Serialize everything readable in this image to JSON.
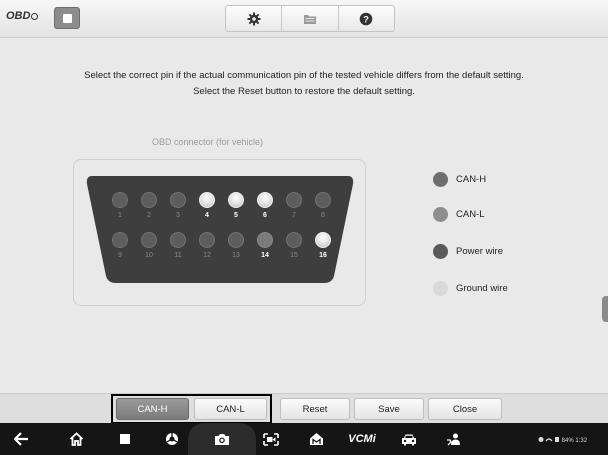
{
  "topbar": {
    "logo_text": "OBD",
    "stop_icon": "stop-square-icon",
    "buttons": [
      {
        "name": "settings",
        "icon": "gear-icon"
      },
      {
        "name": "files",
        "icon": "folder-icon"
      },
      {
        "name": "help",
        "icon": "help-icon"
      }
    ]
  },
  "instruction": {
    "line1": "Select the correct pin if the actual communication pin of the tested vehicle differs from the default setting.",
    "line2": "Select the Reset button to restore the default setting."
  },
  "connector": {
    "label": "OBD connector (for vehicle)",
    "top_row": [
      {
        "num": "1",
        "state": "off"
      },
      {
        "num": "2",
        "state": "off"
      },
      {
        "num": "3",
        "state": "off"
      },
      {
        "num": "4",
        "state": "ground"
      },
      {
        "num": "5",
        "state": "ground"
      },
      {
        "num": "6",
        "state": "ground"
      },
      {
        "num": "7",
        "state": "off"
      },
      {
        "num": "8",
        "state": "off"
      }
    ],
    "bottom_row": [
      {
        "num": "9",
        "state": "off"
      },
      {
        "num": "10",
        "state": "off"
      },
      {
        "num": "11",
        "state": "off"
      },
      {
        "num": "12",
        "state": "off"
      },
      {
        "num": "13",
        "state": "off"
      },
      {
        "num": "14",
        "state": "power"
      },
      {
        "num": "15",
        "state": "off"
      },
      {
        "num": "16",
        "state": "ground"
      }
    ]
  },
  "legend": {
    "items": [
      {
        "label": "CAN-H",
        "color": "#6f6f6f"
      },
      {
        "label": "CAN-L",
        "color": "#8e8e8e"
      },
      {
        "label": "Power wire",
        "color": "#5a5a5a"
      },
      {
        "label": "Ground wire",
        "color": "#d9d9d9"
      }
    ]
  },
  "bottom_toolbar": {
    "can_h": "CAN-H",
    "can_l": "CAN-L",
    "reset": "Reset",
    "save": "Save",
    "close": "Close"
  },
  "sysnav": {
    "icons": [
      "back-icon",
      "home-icon",
      "recent-apps-icon",
      "browser-icon",
      "camera-icon",
      "screen-record-icon",
      "maxifix-icon",
      "vcmi-icon",
      "car-icon",
      "user-icon"
    ],
    "vcmi_label": "VCMi",
    "status_text": "84% 1:32"
  },
  "colors": {
    "connector_body": "#3e3e3e",
    "pin_off": "#5d5d5d",
    "accent_pressed": "#8a8a8a"
  }
}
